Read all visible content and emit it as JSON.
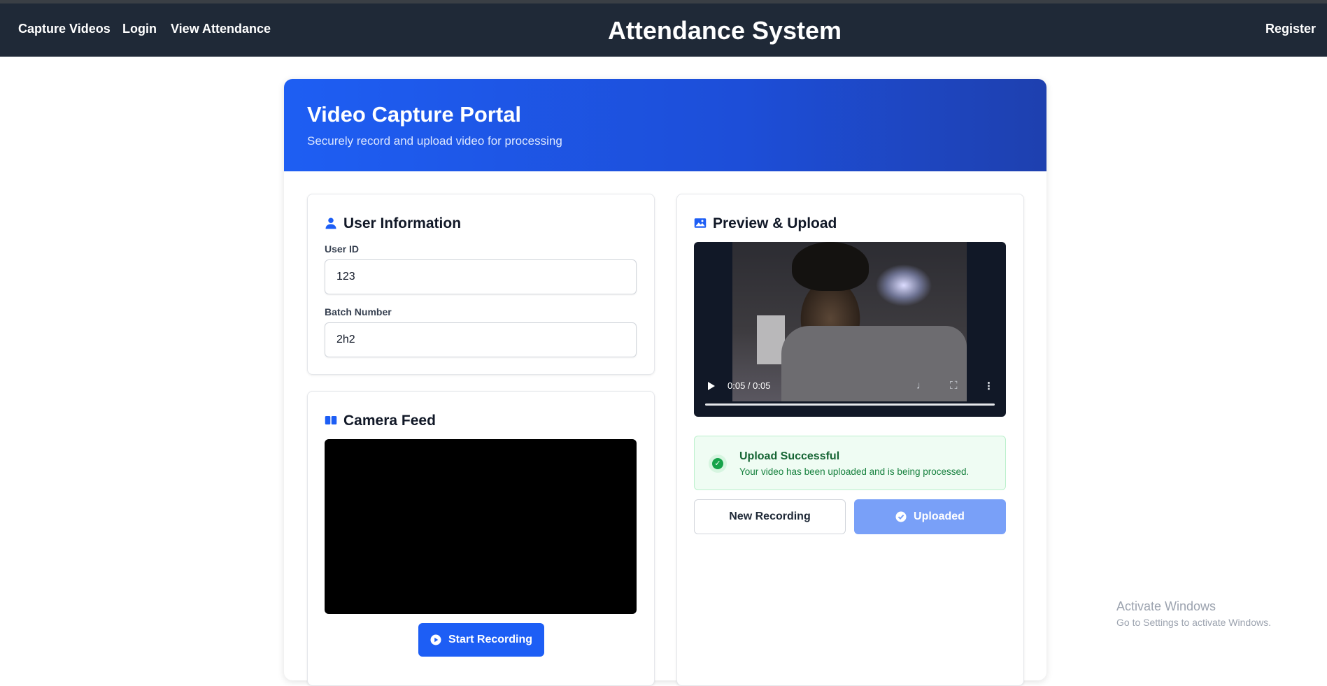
{
  "nav": {
    "links": [
      "Capture Videos",
      "Login",
      "View Attendance"
    ],
    "brand": "Attendance System",
    "register": "Register"
  },
  "hero": {
    "title": "Video Capture Portal",
    "subtitle": "Securely record and upload video for processing"
  },
  "user_info": {
    "title": "User Information",
    "user_id_label": "User ID",
    "user_id_value": "123",
    "batch_label": "Batch Number",
    "batch_value": "2h2"
  },
  "camera": {
    "title": "Camera Feed",
    "start_label": "Start Recording"
  },
  "preview": {
    "title": "Preview & Upload",
    "time": "0:05 / 0:05",
    "progress": 1.0,
    "alert_title": "Upload Successful",
    "alert_text": "Your video has been uploaded and is being processed.",
    "new_recording": "New Recording",
    "uploaded": "Uploaded"
  },
  "watermark": {
    "line1": "Activate Windows",
    "line2": "Go to Settings to activate Windows."
  },
  "colors": {
    "nav_bg": "#1f2937",
    "accent": "#1d5ef5",
    "success": "#16a34a"
  }
}
